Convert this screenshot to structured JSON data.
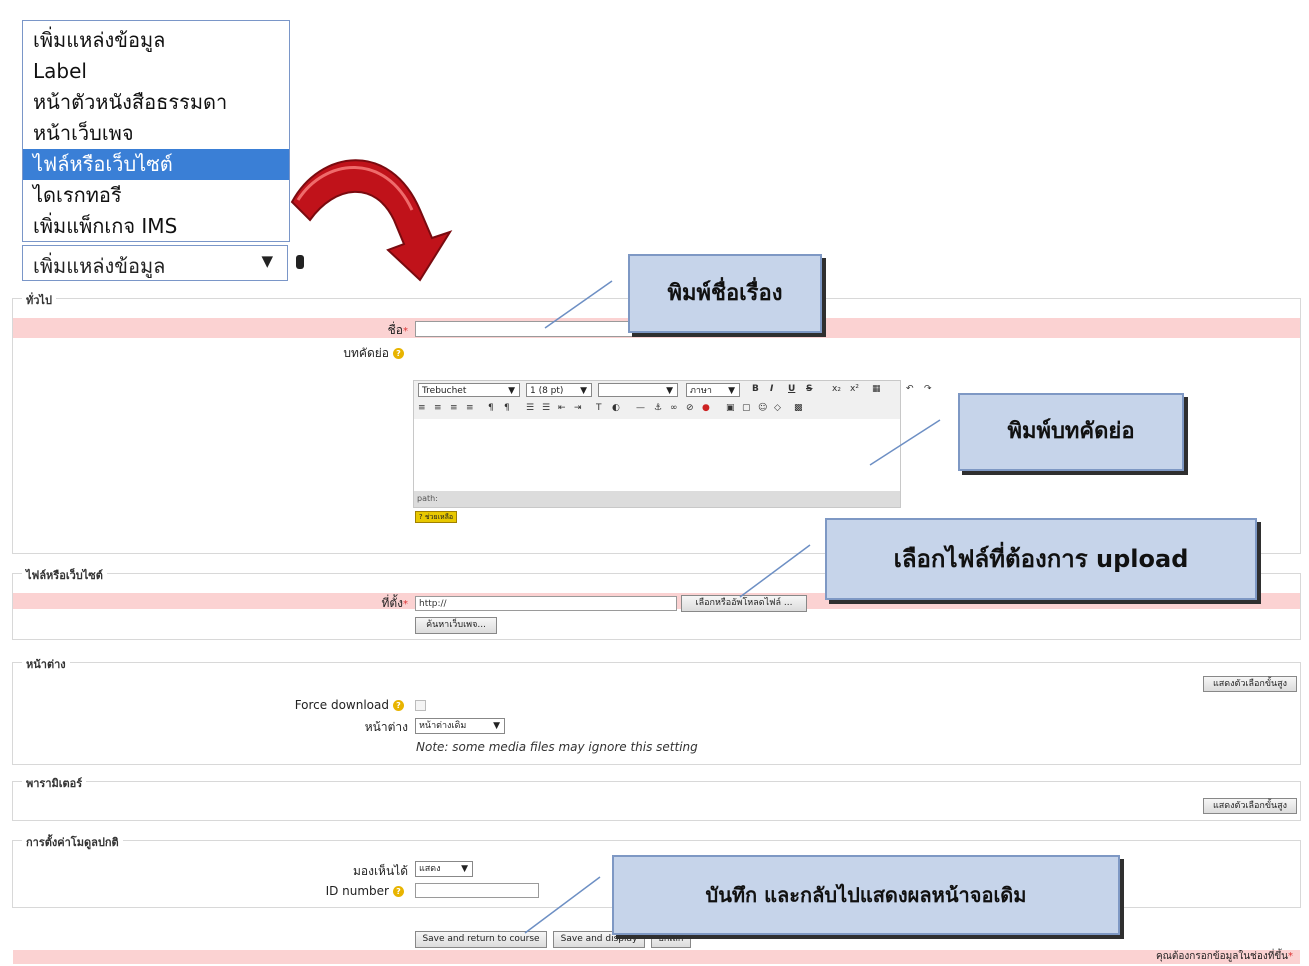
{
  "dropdown": {
    "items": [
      "เพิ่มแหล่งข้อมูล",
      "Label",
      "หน้าตัวหนังสือธรรมดา",
      "หน้าเว็บเพจ",
      "ไฟล์หรือเว็บไซต์",
      "ไดเรกทอรี",
      "เพิ่มแพ็กเกจ IMS"
    ],
    "selected_index": 4,
    "collapsed_value": "เพิ่มแหล่งข้อมูล"
  },
  "general": {
    "legend": "ทั่วไป",
    "name_label": "ชื่อ",
    "name_value": "",
    "summary_label": "บทคัดย่อ",
    "editor": {
      "font": "Trebuchet",
      "size": "1 (8 pt)",
      "style": "",
      "lang": "ภาษา",
      "path_label": "path:",
      "help_badge": "? ช่วยเหลือ"
    }
  },
  "file_section": {
    "legend": "ไฟล์หรือเว็บไซต์",
    "location_label": "ที่ตั้ง",
    "location_value": "http://",
    "choose_button": "เลือกหรืออัพโหลดไฟล์ ...",
    "search_button": "ค้นหาเว็บเพจ..."
  },
  "window_section": {
    "legend": "หน้าต่าง",
    "advanced_button": "แสดงตัวเลือกขั้นสูง",
    "force_label": "Force download",
    "window_label": "หน้าต่าง",
    "window_value": "หน้าต่างเดิม",
    "note": "Note: some media files may ignore this setting"
  },
  "params_section": {
    "legend": "พารามิเตอร์",
    "advanced_button": "แสดงตัวเลือกขั้นสูง"
  },
  "module_section": {
    "legend": "การตั้งค่าโมดูลปกติ",
    "visible_label": "มองเห็นได้",
    "visible_value": "แสดง",
    "id_label": "ID number"
  },
  "footer": {
    "save_return": "Save and return to course",
    "save_display": "Save and display",
    "cancel": "ยกเลิก",
    "required_note": "คุณต้องกรอกข้อมูลในช่องที่ขึ้น"
  },
  "callouts": {
    "title": "พิมพ์ชื่อเรื่อง",
    "summary": "พิมพ์บทคัดย่อ",
    "upload": "เลือกไฟล์ที่ต้องการ upload",
    "save": "บันทึก และกลับไปแสดงผลหน้าจอเดิม"
  },
  "colors": {
    "required_row": "#fbd2d2",
    "selected_item": "#3a7fd6",
    "callout_bg": "#c6d4ea",
    "arrow": "#c0121a"
  }
}
